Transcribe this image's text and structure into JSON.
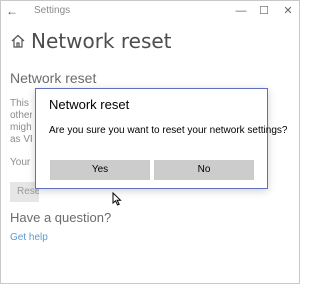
{
  "window": {
    "app_title": "Settings",
    "controls": {
      "minimize": "—",
      "maximize": "☐",
      "close": "✕"
    }
  },
  "page": {
    "title": "Network reset",
    "section_title": "Network reset",
    "partial_lines": [
      "This w",
      "other u",
      "might",
      "as VPN",
      "Your P"
    ],
    "reset_button": "Rese",
    "question_title": "Have a question?",
    "help_link": "Get help"
  },
  "dialog": {
    "title": "Network reset",
    "message": "Are you sure you want to reset your network settings?",
    "yes_label": "Yes",
    "no_label": "No"
  },
  "colors": {
    "accent": "#5b9bd5",
    "dialog_border": "#5e6fc4",
    "button_bg": "#cccccc"
  }
}
